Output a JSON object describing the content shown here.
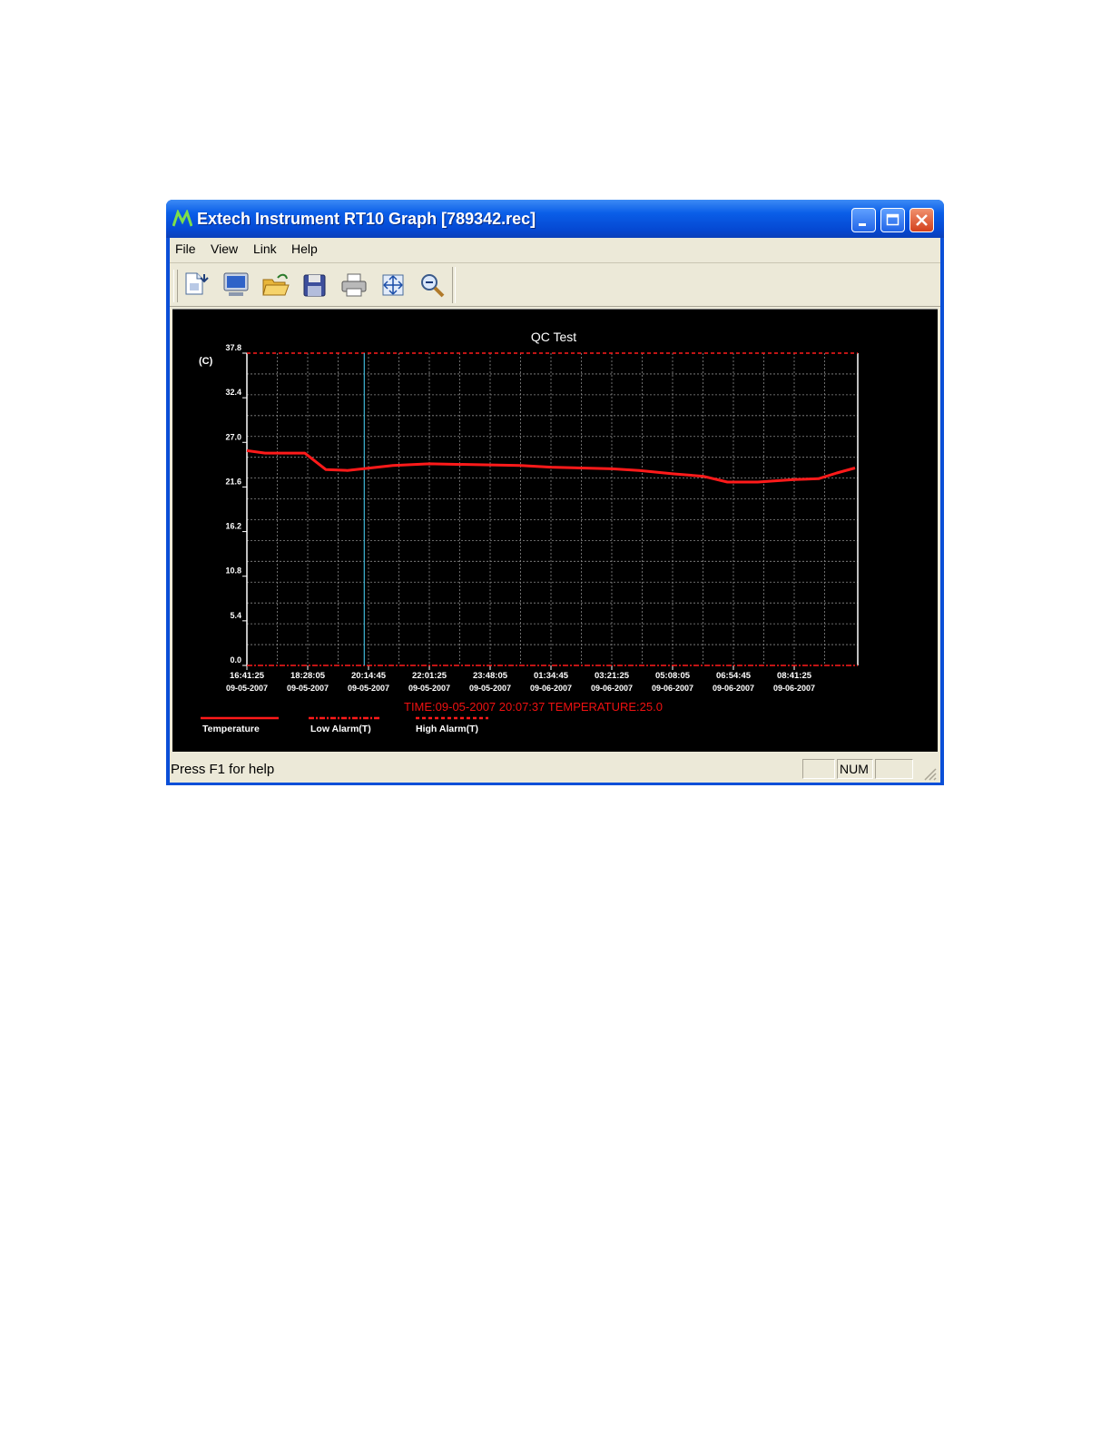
{
  "window": {
    "title": "Extech Instrument RT10 Graph [789342.rec]",
    "icon": "extech-logo-icon",
    "controls": [
      "minimize-icon",
      "maximize-icon",
      "close-icon"
    ]
  },
  "menu": {
    "items": [
      "File",
      "View",
      "Link",
      "Help"
    ]
  },
  "toolbar": {
    "tools": [
      "new-file-icon",
      "monitor-icon",
      "open-folder-icon",
      "save-disk-icon",
      "print-icon",
      "fit-view-icon",
      "zoom-out-icon"
    ]
  },
  "status": {
    "text": "Press F1 for help",
    "pane_num": "NUM"
  },
  "colors": {
    "chart_background": "#000000",
    "temperature_line": "#ff1a1a",
    "cursor_line": "#3fb7d6",
    "grid": "#8a8a8a",
    "readout": "#ee1111",
    "titlebar": "#0548d2"
  },
  "readout": "TIME:09-05-2007 20:07:37   TEMPERATURE:25.0",
  "chart_data": {
    "type": "line",
    "title": "QC Test",
    "ylabel": "(C)",
    "ylim": [
      0,
      37.8
    ],
    "yticks": [
      "37.8",
      "32.4",
      "27.0",
      "21.6",
      "16.2",
      "10.8",
      "5.4",
      "0.0"
    ],
    "xticks": [
      {
        "time": "16:41:25",
        "date": "09-05-2007"
      },
      {
        "time": "18:28:05",
        "date": "09-05-2007"
      },
      {
        "time": "20:14:45",
        "date": "09-05-2007"
      },
      {
        "time": "22:01:25",
        "date": "09-05-2007"
      },
      {
        "time": "23:48:05",
        "date": "09-05-2007"
      },
      {
        "time": "01:34:45",
        "date": "09-06-2007"
      },
      {
        "time": "03:21:25",
        "date": "09-06-2007"
      },
      {
        "time": "05:08:05",
        "date": "09-06-2007"
      },
      {
        "time": "06:54:45",
        "date": "09-06-2007"
      },
      {
        "time": "08:41:25",
        "date": "09-06-2007"
      }
    ],
    "grid": true,
    "legend": [
      {
        "label": "Temperature",
        "style": "solid"
      },
      {
        "label": "Low Alarm(T)",
        "style": "dash-dot"
      },
      {
        "label": "High Alarm(T)",
        "style": "dashed"
      }
    ],
    "legend_position": "bottom-left",
    "series": [
      {
        "name": "Temperature",
        "x_tick_index": [
          0,
          0.3,
          0.95,
          1.3,
          1.65,
          2.4,
          3.0,
          4.5,
          5.0,
          6.0,
          6.45,
          7.0,
          7.5,
          7.9,
          8.4,
          9.0,
          9.4,
          9.7,
          10.0
        ],
        "values": [
          26.0,
          25.7,
          25.7,
          23.7,
          23.6,
          24.2,
          24.4,
          24.2,
          24.0,
          23.8,
          23.6,
          23.2,
          22.9,
          22.2,
          22.2,
          22.5,
          22.6,
          23.3,
          23.9
        ]
      },
      {
        "name": "Low Alarm(T)",
        "constant": 0.0
      },
      {
        "name": "High Alarm(T)",
        "constant": 37.8
      }
    ],
    "cursor": {
      "time": "20:07:37",
      "x_tick_index": 1.93
    }
  }
}
